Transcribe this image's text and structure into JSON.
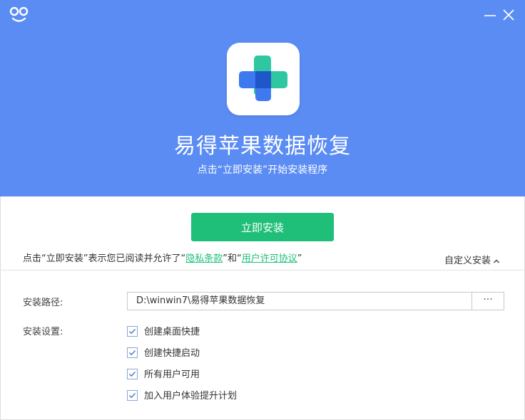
{
  "app": {
    "title": "易得苹果数据恢复",
    "subtitle": "点击“立即安装”开始安装程序"
  },
  "colors": {
    "header_bg": "#5b8cf4",
    "accent_green": "#1fbf7a"
  },
  "window": {
    "minimize_icon": "minimize-icon",
    "close_icon": "close-icon"
  },
  "install": {
    "button_label": "立即安装",
    "agree_prefix": "点击“立即安装”表示您已阅读并允许了“",
    "privacy_link": "隐私条款",
    "agree_middle": "”和“",
    "license_link": "用户许可协议",
    "agree_suffix": "”",
    "custom_label": "自定义安装"
  },
  "settings": {
    "path_label": "安装路径:",
    "path_value": "D:\\winwin7\\易得苹果数据恢复",
    "browse_label": "···",
    "options_label": "安装设置:",
    "options": [
      {
        "label": "创建桌面快捷",
        "checked": true
      },
      {
        "label": "创建快捷启动",
        "checked": true
      },
      {
        "label": "所有用户可用",
        "checked": true
      },
      {
        "label": "加入用户体验提升计划",
        "checked": true
      }
    ]
  }
}
